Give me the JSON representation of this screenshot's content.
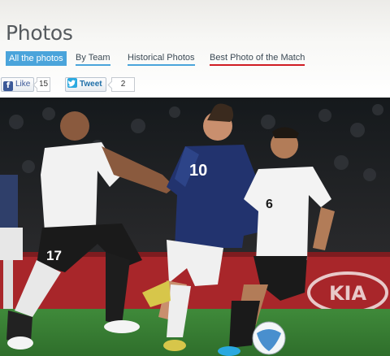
{
  "page": {
    "title": "Photos"
  },
  "tabs": [
    {
      "label": "All the photos",
      "state": "active"
    },
    {
      "label": "By Team",
      "state": "blue-underline"
    },
    {
      "label": "Historical Photos",
      "state": "blue-underline"
    },
    {
      "label": "Best Photo of the Match",
      "state": "red-underline"
    }
  ],
  "social": {
    "like_label": "Like",
    "like_count": "15",
    "tweet_label": "Tweet",
    "tweet_count": "2"
  },
  "photo": {
    "kind": "football-match-photo",
    "jersey_numbers": [
      "17",
      "10",
      "6"
    ],
    "board_text": "KIA"
  },
  "colors": {
    "accent_blue": "#4aa4db",
    "accent_red": "#d01c24",
    "facebook": "#3b5998",
    "twitter": "#2aa9e0"
  }
}
